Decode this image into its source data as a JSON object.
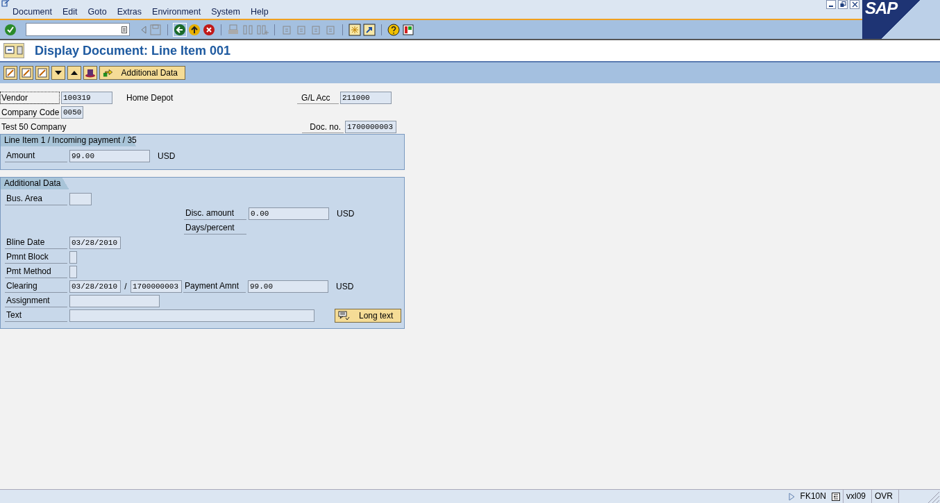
{
  "menu": [
    "Document",
    "Edit",
    "Goto",
    "Extras",
    "Environment",
    "System",
    "Help"
  ],
  "logo": "SAP",
  "title": "Display Document: Line Item 001",
  "app_toolbar": {
    "additional_data_button": "Additional Data"
  },
  "header": {
    "vendor": {
      "label": "Vendor",
      "value": "100319",
      "name": "Home Depot"
    },
    "gl_acc": {
      "label": "G/L Acc",
      "value": "211000"
    },
    "company_code": {
      "label": "Company Code",
      "value": "0050",
      "name": "Test 50 Company"
    },
    "doc_no": {
      "label": "Doc. no.",
      "value": "1700000003"
    }
  },
  "line_item": {
    "title": "Line Item 1 / Incoming payment / 35",
    "amount": {
      "label": "Amount",
      "value": "99.00",
      "currency": "USD"
    }
  },
  "additional_data": {
    "title": "Additional Data",
    "bus_area": {
      "label": "Bus. Area"
    },
    "disc_amount": {
      "label": "Disc. amount",
      "value": "0.00",
      "currency": "USD"
    },
    "days_percent": {
      "label": "Days/percent"
    },
    "bline_date": {
      "label": "Bline Date",
      "value": "03/28/2010"
    },
    "pmnt_block": {
      "label": "Pmnt Block"
    },
    "pmt_method": {
      "label": "Pmt Method"
    },
    "clearing": {
      "label": "Clearing",
      "date": "03/28/2010",
      "separator": "/",
      "document": "1700000003"
    },
    "payment_amnt": {
      "label": "Payment Amnt",
      "value": "99.00",
      "currency": "USD"
    },
    "assignment": {
      "label": "Assignment"
    },
    "text": {
      "label": "Text"
    },
    "long_text_button": "Long text"
  },
  "status_bar": {
    "transaction": "FK10N",
    "server": "vxl09",
    "mode": "OVR"
  }
}
